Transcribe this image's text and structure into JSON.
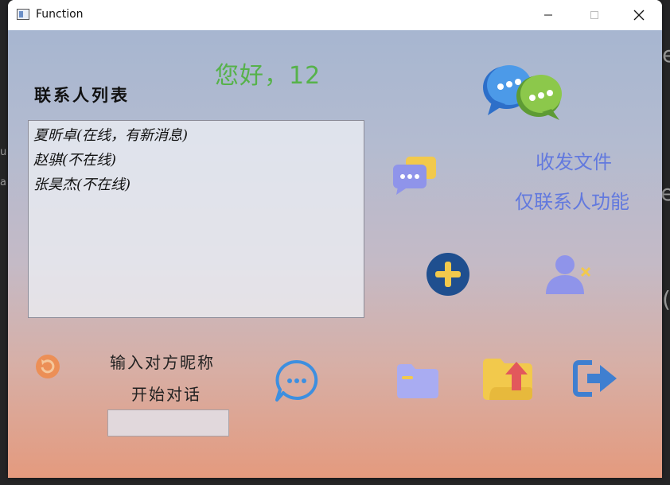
{
  "window": {
    "title": "Function",
    "controls": {
      "minimize_icon": "minimize-icon",
      "maximize_icon": "maximize-icon",
      "close_icon": "close-icon"
    }
  },
  "background": {
    "edge_chars": [
      "e",
      "u",
      "a",
      "e",
      "("
    ]
  },
  "main": {
    "greeting": "您好，12",
    "contacts_title": "联系人列表",
    "contacts": [
      "夏昕卓(在线，有新消息)",
      "赵骐(不在线)",
      "张昊杰(不在线)"
    ],
    "send_file_link": "收发文件",
    "contacts_only_link": "仅联系人功能",
    "input_label": "输入对方昵称",
    "start_label": "开始对话",
    "nickname_value": "",
    "nickname_placeholder": ""
  },
  "icons": {
    "logo": "chat-bubbles-logo-icon",
    "group_chat": "group-chat-icon",
    "add": "add-contact-icon",
    "remove_user": "remove-user-icon",
    "refresh": "refresh-icon",
    "start_chat": "start-chat-icon",
    "folder": "folder-icon",
    "upload": "upload-file-icon",
    "logout": "logout-icon"
  },
  "colors": {
    "greeting": "#56b24a",
    "links": "#6279de",
    "gradient_top": "#a7b6d0",
    "gradient_bottom": "#e49a7e"
  }
}
